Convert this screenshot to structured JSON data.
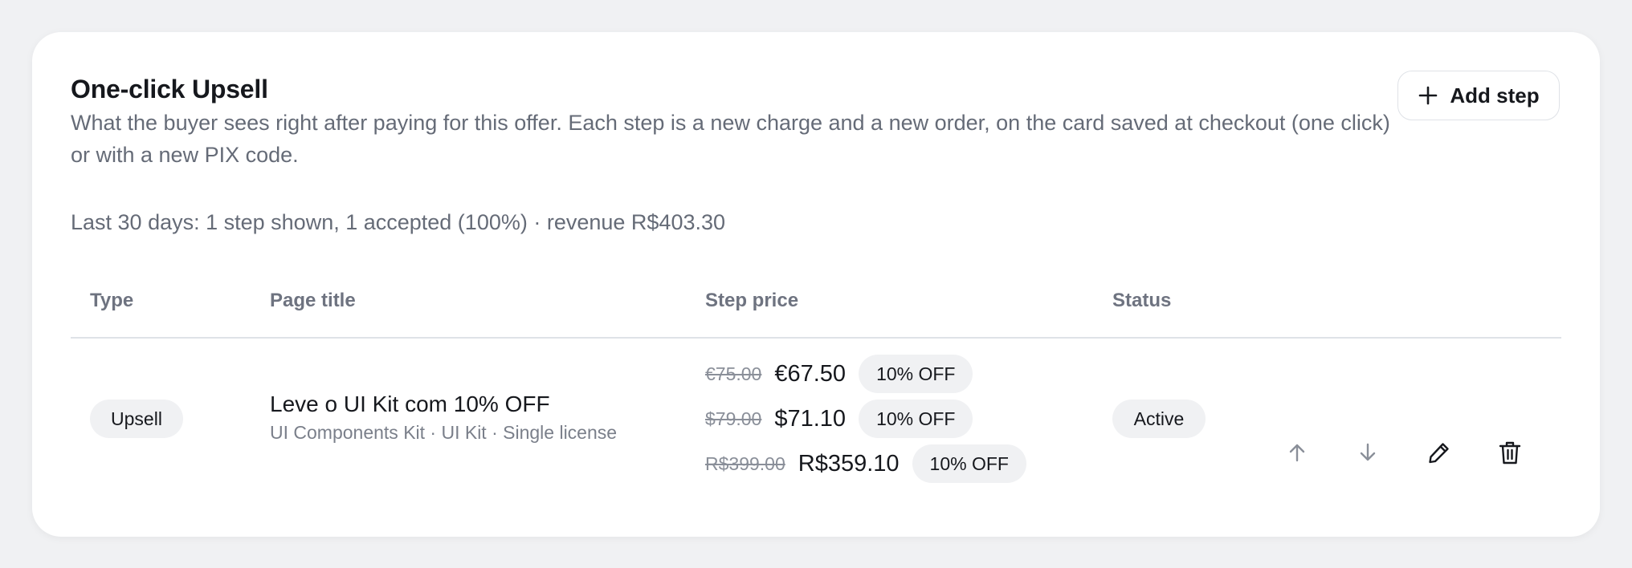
{
  "section": {
    "title": "One-click Upsell",
    "description": "What the buyer sees right after paying for this offer. Each step is a new charge and a new order, on the card saved at checkout (one click) or with a new PIX code.",
    "add_step_label": "Add step",
    "stats": "Last 30 days: 1 step shown, 1 accepted (100%) · revenue R$403.30"
  },
  "table": {
    "headers": {
      "type": "Type",
      "page_title": "Page title",
      "step_price": "Step price",
      "status": "Status"
    },
    "rows": [
      {
        "type": "Upsell",
        "title": "Leve o UI Kit com 10% OFF",
        "subtitle": "UI Components Kit · UI Kit · Single license",
        "prices": [
          {
            "old": "€75.00",
            "new": "€67.50",
            "discount": "10% OFF"
          },
          {
            "old": "$79.00",
            "new": "$71.10",
            "discount": "10% OFF"
          },
          {
            "old": "R$399.00",
            "new": "R$359.10",
            "discount": "10% OFF"
          }
        ],
        "status": "Active"
      }
    ]
  },
  "icons": {
    "add": "plus-icon",
    "move_up": "arrow-up-icon",
    "move_down": "arrow-down-icon",
    "edit": "pencil-icon",
    "delete": "trash-icon"
  },
  "colors": {
    "pill_bg": "#f0f1f3",
    "muted_text": "#656b77",
    "border": "#dfe2e7"
  }
}
